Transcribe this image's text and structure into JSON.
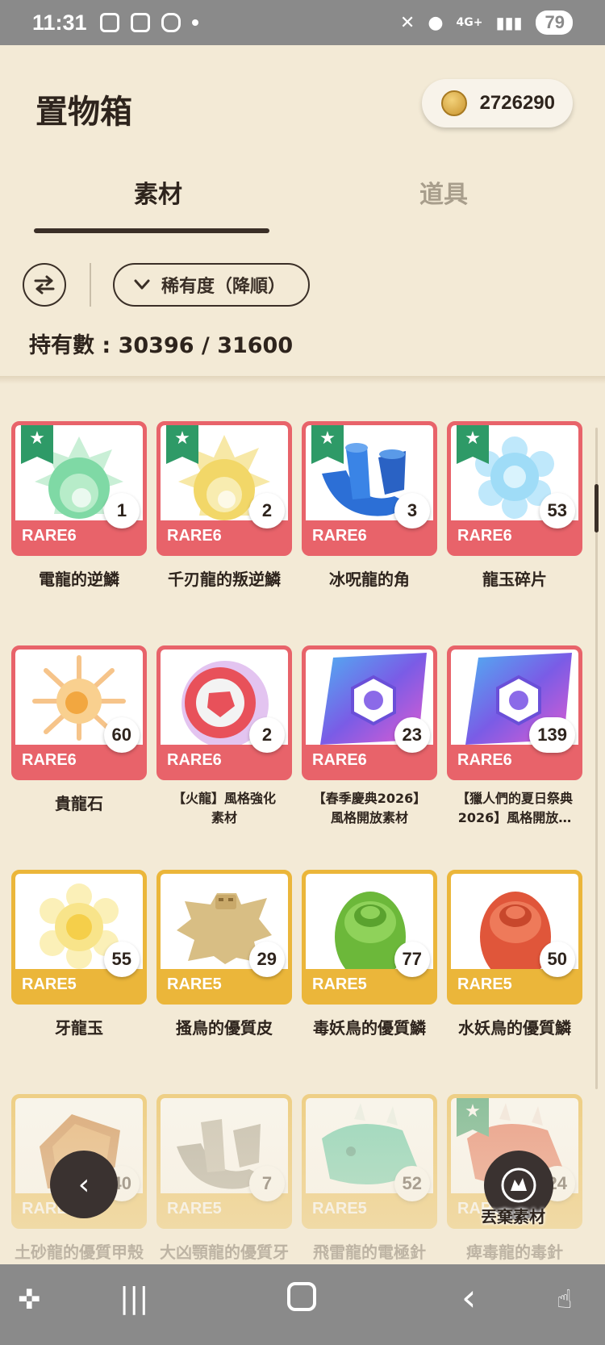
{
  "status_bar": {
    "time": "11:31",
    "network": "4G+",
    "battery": "79"
  },
  "header": {
    "title": "置物箱",
    "coins": "2726290",
    "tabs": [
      {
        "label": "素材",
        "active": true
      },
      {
        "label": "道具",
        "active": false
      }
    ],
    "sort_label": "稀有度（降順）",
    "count_label": "持有數 : 30396 / 31600"
  },
  "items": [
    {
      "name": "電龍的逆鱗",
      "rarity": "RARE6",
      "qty": "1",
      "favorite": true
    },
    {
      "name": "千刃龍的叛逆鱗",
      "rarity": "RARE6",
      "qty": "2",
      "favorite": true
    },
    {
      "name": "冰呪龍的角",
      "rarity": "RARE6",
      "qty": "3",
      "favorite": true
    },
    {
      "name": "龍玉碎片",
      "rarity": "RARE6",
      "qty": "53",
      "favorite": true
    },
    {
      "name": "貴龍石",
      "rarity": "RARE6",
      "qty": "60",
      "favorite": false
    },
    {
      "name_line1": "【火龍】風格強化",
      "name_line2": "素材",
      "rarity": "RARE6",
      "qty": "2",
      "favorite": false
    },
    {
      "name_line1": "【春季慶典2026】",
      "name_line2": "風格開放素材",
      "rarity": "RARE6",
      "qty": "23",
      "favorite": false
    },
    {
      "name_line1": "【獵人們的夏日祭典",
      "name_line2": "2026】風格開放…",
      "rarity": "RARE6",
      "qty": "139",
      "favorite": false
    },
    {
      "name": "牙龍玉",
      "rarity": "RARE5",
      "qty": "55",
      "favorite": false
    },
    {
      "name": "搔鳥的優質皮",
      "rarity": "RARE5",
      "qty": "29",
      "favorite": false
    },
    {
      "name": "毒妖鳥的優質鱗",
      "rarity": "RARE5",
      "qty": "77",
      "favorite": false
    },
    {
      "name": "水妖鳥的優質鱗",
      "rarity": "RARE5",
      "qty": "50",
      "favorite": false
    },
    {
      "name": "土砂龍的優質甲殼",
      "rarity": "RARE5",
      "qty": "40",
      "favorite": false
    },
    {
      "name": "大凶顎龍的優質牙",
      "rarity": "RARE5",
      "qty": "7",
      "favorite": false
    },
    {
      "name": "飛雷龍的電極針",
      "rarity": "RARE5",
      "qty": "52",
      "favorite": false
    },
    {
      "name": "痺毒龍的毒針",
      "rarity": "RARE5",
      "qty": "24",
      "favorite": true
    }
  ],
  "floating": {
    "discard_label": "丟棄素材"
  },
  "colors": {
    "rare6": "#e8636a",
    "rare5": "#ebb63a",
    "favorite": "#2e9a67",
    "background": "#f3ead6"
  }
}
